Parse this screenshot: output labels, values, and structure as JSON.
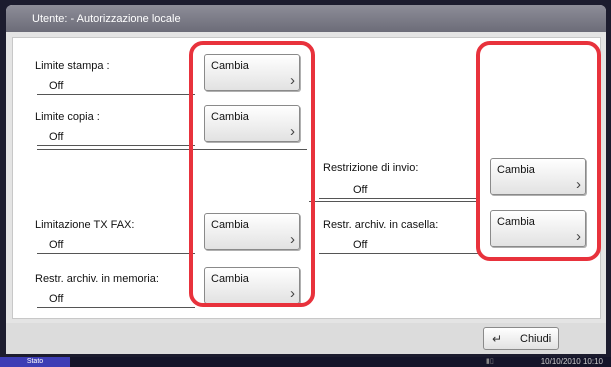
{
  "header": {
    "title": "Utente:  - Autorizzazione locale"
  },
  "rows_left": [
    {
      "label": "Limite stampa :",
      "value": "Off",
      "button": "Cambia"
    },
    {
      "label": "Limite copia :",
      "value": "Off",
      "button": "Cambia"
    },
    {
      "label": "Limitazione TX FAX:",
      "value": "Off",
      "button": "Cambia"
    },
    {
      "label": "Restr. archiv. in memoria:",
      "value": "Off",
      "button": "Cambia"
    }
  ],
  "rows_right": [
    {
      "label": "Restrizione di invio:",
      "value": "Off",
      "button": "Cambia"
    },
    {
      "label": "Restr. archiv. in casella:",
      "value": "Off",
      "button": "Cambia"
    }
  ],
  "footer": {
    "close_label": "Chiudi"
  },
  "status": {
    "tab_label": "Stato",
    "datetime": "10/10/2010  10:10"
  },
  "colors": {
    "highlight": "#e8323c",
    "header": "#7a7a86",
    "status_tab": "#3d3db5"
  },
  "icons": {
    "chevron": "chevron-right-icon",
    "close": "return-arrow-icon"
  }
}
